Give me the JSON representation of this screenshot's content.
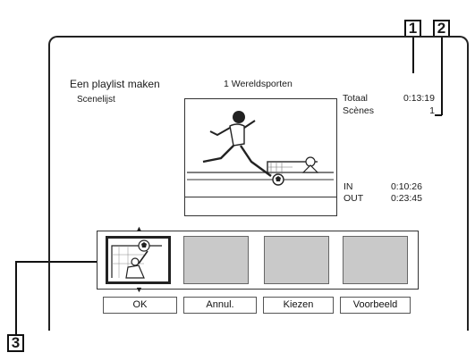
{
  "header": {
    "title": "Een playlist maken",
    "subtitle": "Scenelijst",
    "program": "1 Wereldsporten"
  },
  "info": {
    "total_label": "Totaal",
    "total_value": "0:13:19",
    "scenes_label": "Scènes",
    "scenes_value": "1",
    "in_label": "IN",
    "in_value": "0:10:26",
    "out_label": "OUT",
    "out_value": "0:23:45"
  },
  "buttons": {
    "ok": "OK",
    "cancel": "Annul.",
    "select": "Kiezen",
    "preview": "Voorbeeld"
  },
  "callouts": {
    "c1": "1",
    "c2": "2",
    "c3": "3"
  },
  "icons": {
    "scroll_up": "arrow-up-icon",
    "scroll_down": "arrow-down-icon"
  }
}
